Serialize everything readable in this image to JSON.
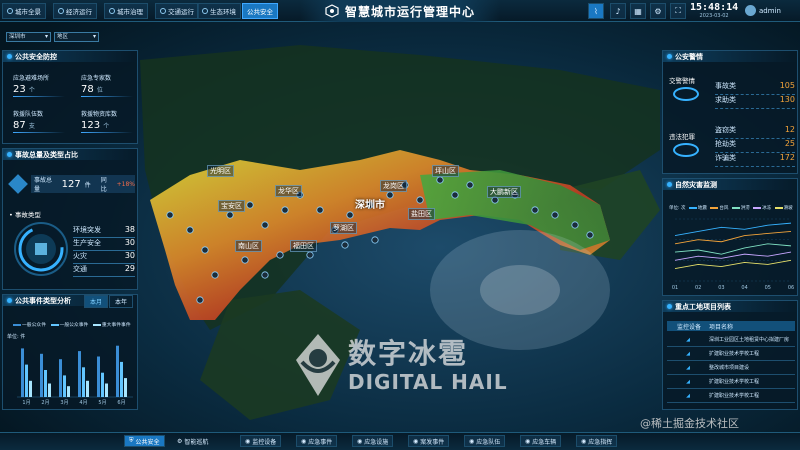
{
  "topnav": [
    {
      "label": "城市全景"
    },
    {
      "label": "经济运行"
    },
    {
      "label": "城市治理"
    },
    {
      "label": "交通运行"
    },
    {
      "label": "生态环境"
    },
    {
      "label": "公共安全"
    }
  ],
  "title": "智慧城市运行管理中心",
  "clock": {
    "time": "15:48:14",
    "date": "2023-03-02"
  },
  "user": {
    "name": "admin"
  },
  "filters": [
    "深圳市",
    "地区"
  ],
  "left": {
    "safety": {
      "title": "公共安全防控",
      "stats": [
        {
          "label": "应急避难场所",
          "value": "23",
          "unit": "个"
        },
        {
          "label": "应急专家数",
          "value": "78",
          "unit": "位"
        },
        {
          "label": "救援队伍数",
          "value": "87",
          "unit": "支"
        },
        {
          "label": "救援物资库数",
          "value": "123",
          "unit": "个"
        }
      ]
    },
    "accidents": {
      "title": "事故总量及类型占比",
      "total_label": "事故总量",
      "total_value": "127",
      "total_unit": "件",
      "compare_label": "同比",
      "compare_value": "+18%",
      "types_title": "事故类型",
      "types": [
        {
          "label": "环境突发",
          "value": "38"
        },
        {
          "label": "生产安全",
          "value": "30"
        },
        {
          "label": "火灾",
          "value": "30"
        },
        {
          "label": "交通",
          "value": "29"
        }
      ]
    },
    "analysis": {
      "title": "公共事件类型分析",
      "tabs": [
        "本月",
        "本年"
      ],
      "legend": [
        "一般公众件",
        "一般公众事件",
        "重大事件事件"
      ],
      "ylabel": "单位: 件"
    }
  },
  "right": {
    "police": {
      "title": "公安警情",
      "groups": [
        {
          "name": "交警警情",
          "items": [
            {
              "label": "事故类",
              "value": "105"
            },
            {
              "label": "求助类",
              "value": "130"
            }
          ]
        },
        {
          "name": "违法犯罪",
          "items": [
            {
              "label": "盗窃类",
              "value": "12"
            },
            {
              "label": "抢劫类",
              "value": "25"
            },
            {
              "label": "诈骗类",
              "value": "172"
            }
          ]
        }
      ]
    },
    "disaster": {
      "title": "自然灾害监测",
      "legend": [
        "单位: 次",
        "地震",
        "台风",
        "洪涝",
        "冰冻",
        "滑坡"
      ]
    },
    "construction": {
      "title": "重点工地项目列表",
      "headers": [
        "监控设备",
        "项目名称"
      ],
      "rows": [
        "深圳工业园区土地租赁中心拟建厂房",
        "扩建职业技术学校工程",
        "整改城市项目建设",
        "扩建职业技术学校工程",
        "扩建职业技术学校工程"
      ]
    }
  },
  "map": {
    "city": "深圳市",
    "districts": [
      "光明区",
      "龙华区",
      "宝安区",
      "南山区",
      "福田区",
      "龙岗区",
      "罗湖区",
      "盐田区",
      "大鹏新区",
      "坪山区"
    ]
  },
  "watermark": {
    "cn": "数字冰雹",
    "en": "DIGITAL HAIL"
  },
  "bottomnav": [
    "公共安全",
    "智能巡航",
    "监控设备",
    "应急事件",
    "应急设施",
    "案发事件",
    "应急队伍",
    "应急车辆",
    "应急指挥"
  ],
  "credit": "@稀土掘金技术社区",
  "chart_data": [
    {
      "type": "bar",
      "title": "公共事件类型分析",
      "categories": [
        "1月",
        "2月",
        "3月",
        "4月",
        "5月",
        "6月"
      ],
      "series": [
        {
          "name": "一般公众件",
          "values": [
            18,
            16,
            14,
            17,
            15,
            19
          ]
        },
        {
          "name": "一般公众事件",
          "values": [
            12,
            10,
            8,
            11,
            9,
            13
          ]
        },
        {
          "name": "重大事件事件",
          "values": [
            6,
            5,
            4,
            6,
            5,
            7
          ]
        }
      ],
      "ylim": [
        0,
        20
      ]
    },
    {
      "type": "line",
      "title": "自然灾害监测",
      "x": [
        "01",
        "02",
        "03",
        "04",
        "05",
        "06"
      ],
      "series": [
        {
          "name": "地震",
          "values": [
            22,
            24,
            26,
            25,
            27,
            28
          ]
        },
        {
          "name": "台风",
          "values": [
            18,
            20,
            19,
            22,
            23,
            24
          ]
        },
        {
          "name": "洪涝",
          "values": [
            14,
            15,
            13,
            16,
            18,
            17
          ]
        },
        {
          "name": "冰冻",
          "values": [
            10,
            12,
            11,
            13,
            12,
            14
          ]
        },
        {
          "name": "滑坡",
          "values": [
            6,
            8,
            7,
            9,
            8,
            10
          ]
        }
      ],
      "ylim": [
        0,
        30
      ]
    }
  ],
  "colors": {
    "accent": "#1a78c2",
    "highlight": "#36b2ff",
    "orange": "#f2a33a",
    "bar1": "#3b8ed6",
    "bar2": "#63c6ff",
    "bar3": "#a8e6ff"
  }
}
